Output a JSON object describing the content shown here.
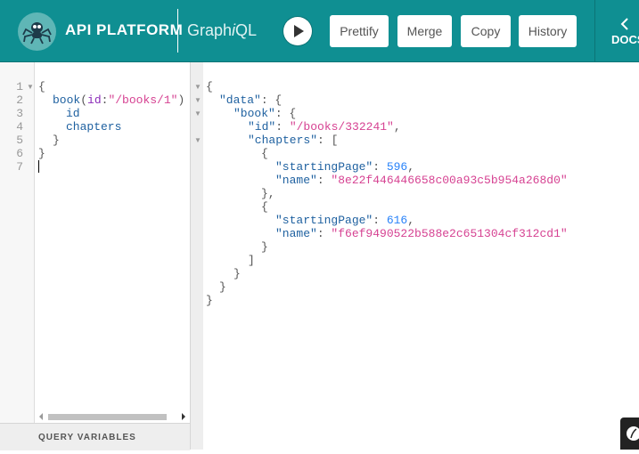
{
  "header": {
    "logo_text": "API PLATFORM",
    "title_prefix": "Graph",
    "title_i": "i",
    "title_suffix": "QL",
    "buttons": [
      "Prettify",
      "Merge",
      "Copy",
      "History"
    ],
    "docs_label": "DOCS"
  },
  "query_editor": {
    "line_numbers": [
      "1",
      "2",
      "3",
      "4",
      "5",
      "6",
      "7"
    ],
    "lines": {
      "l1": "{",
      "l2_field": "book",
      "l2_open": "(",
      "l2_arg": "id",
      "l2_colon": ":",
      "l2_value": "\"/books/1\"",
      "l2_close": ")",
      "l3": "id",
      "l4": "chapters",
      "l5": "}",
      "l6": "}"
    }
  },
  "query_variables_label": "QUERY VARIABLES",
  "result": {
    "open_brace": "{",
    "data_key": "\"data\"",
    "book_key": "\"book\"",
    "id_key": "\"id\"",
    "id_value": "\"/books/332241\"",
    "chapters_key": "\"chapters\"",
    "chapters": [
      {
        "startingPage_key": "\"startingPage\"",
        "startingPage": "596",
        "name_key": "\"name\"",
        "name": "\"8e22f446446658c00a93c5b954a268d0\""
      },
      {
        "startingPage_key": "\"startingPage\"",
        "startingPage": "616",
        "name_key": "\"name\"",
        "name": "\"f6ef9490522b588e2c651304cf312cd1\""
      }
    ]
  },
  "colors": {
    "header_bg": "#0f8f92",
    "key": "#1f61a0",
    "string": "#d64292",
    "number": "#2882f9",
    "argument": "#8b2bb9"
  },
  "icons": [
    "spider-logo-icon",
    "play-icon",
    "chevron-left-icon",
    "fold-arrow-icon",
    "symfony-badge-icon"
  ]
}
